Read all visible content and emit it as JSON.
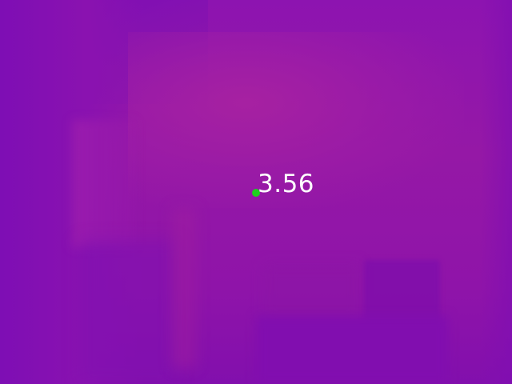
{
  "measurement": {
    "value_text": "3.56",
    "marker_color": "#1ed11e",
    "label_color": "#ffffff"
  },
  "colors": {
    "background_primary": "#8a12ad",
    "background_warm": "#a823a0",
    "background_cool": "#7c0db6"
  }
}
